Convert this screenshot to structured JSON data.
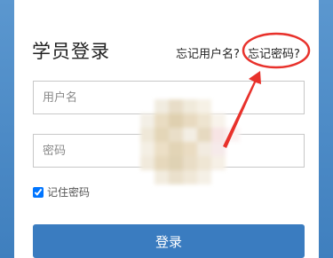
{
  "page": {
    "background_color": "#4a88c6",
    "accent_color": "#3a7cc0"
  },
  "header": {
    "title": "学员登录",
    "forgot_username": "忘记用户名?",
    "forgot_password": "忘记密码?"
  },
  "form": {
    "username_placeholder": "用户名",
    "password_placeholder": "密码",
    "remember_label": "记住密码",
    "remember_checked": true,
    "login_label": "登录"
  },
  "annotation": {
    "color": "#e8312b",
    "icon": "red-circle-and-arrow"
  }
}
